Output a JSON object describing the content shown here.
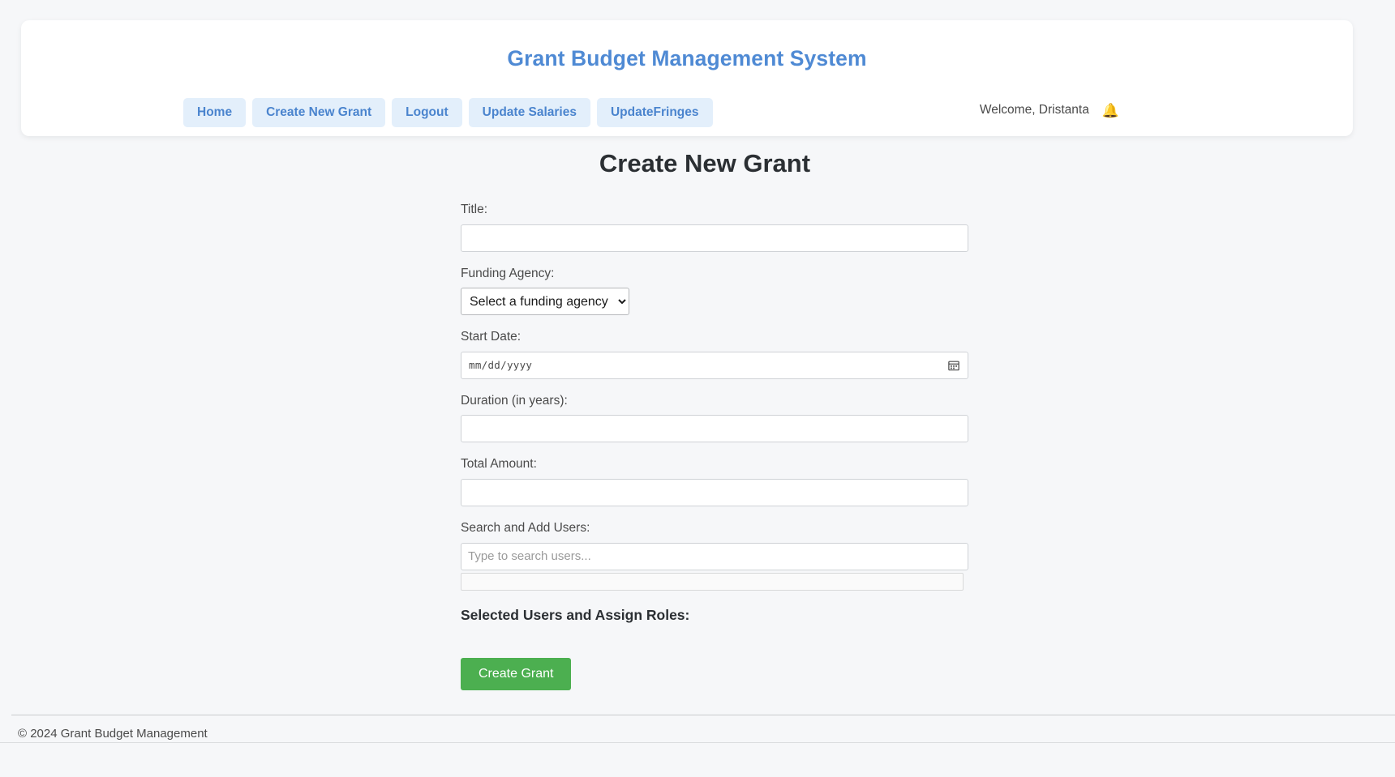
{
  "header": {
    "app_title": "Grant Budget Management System",
    "brand_color": "#4f8ad4",
    "nav": [
      {
        "label": "Home",
        "name": "nav-home"
      },
      {
        "label": "Create New Grant",
        "name": "nav-create-new-grant"
      },
      {
        "label": "Logout",
        "name": "nav-logout"
      },
      {
        "label": "Update Salaries",
        "name": "nav-update-salaries"
      },
      {
        "label": "UpdateFringes",
        "name": "nav-update-fringes"
      }
    ],
    "welcome_text": "Welcome, Dristanta",
    "notification_icon": "bell-icon",
    "notification_color": "#f5b92c"
  },
  "page": {
    "title": "Create New Grant"
  },
  "form": {
    "title_field": {
      "label": "Title:",
      "value": "",
      "placeholder": ""
    },
    "funding_agency_field": {
      "label": "Funding Agency:",
      "selected": "Select a funding agency",
      "options": [
        "Select a funding agency"
      ]
    },
    "start_date_field": {
      "label": "Start Date:",
      "value": "",
      "placeholder": "mm/dd/yyyy",
      "icon": "calendar-icon"
    },
    "duration_field": {
      "label": "Duration (in years):",
      "value": "",
      "placeholder": ""
    },
    "total_amount_field": {
      "label": "Total Amount:",
      "value": "",
      "placeholder": ""
    },
    "search_users_field": {
      "label": "Search and Add Users:",
      "value": "",
      "placeholder": "Type to search users..."
    },
    "search_results": {
      "items": []
    },
    "selected_users_heading": "Selected Users and Assign Roles:",
    "selected_users": [],
    "submit_label": "Create Grant",
    "submit_color": "#4caf50"
  },
  "footer": {
    "copyright": "© 2024 Grant Budget Management"
  }
}
